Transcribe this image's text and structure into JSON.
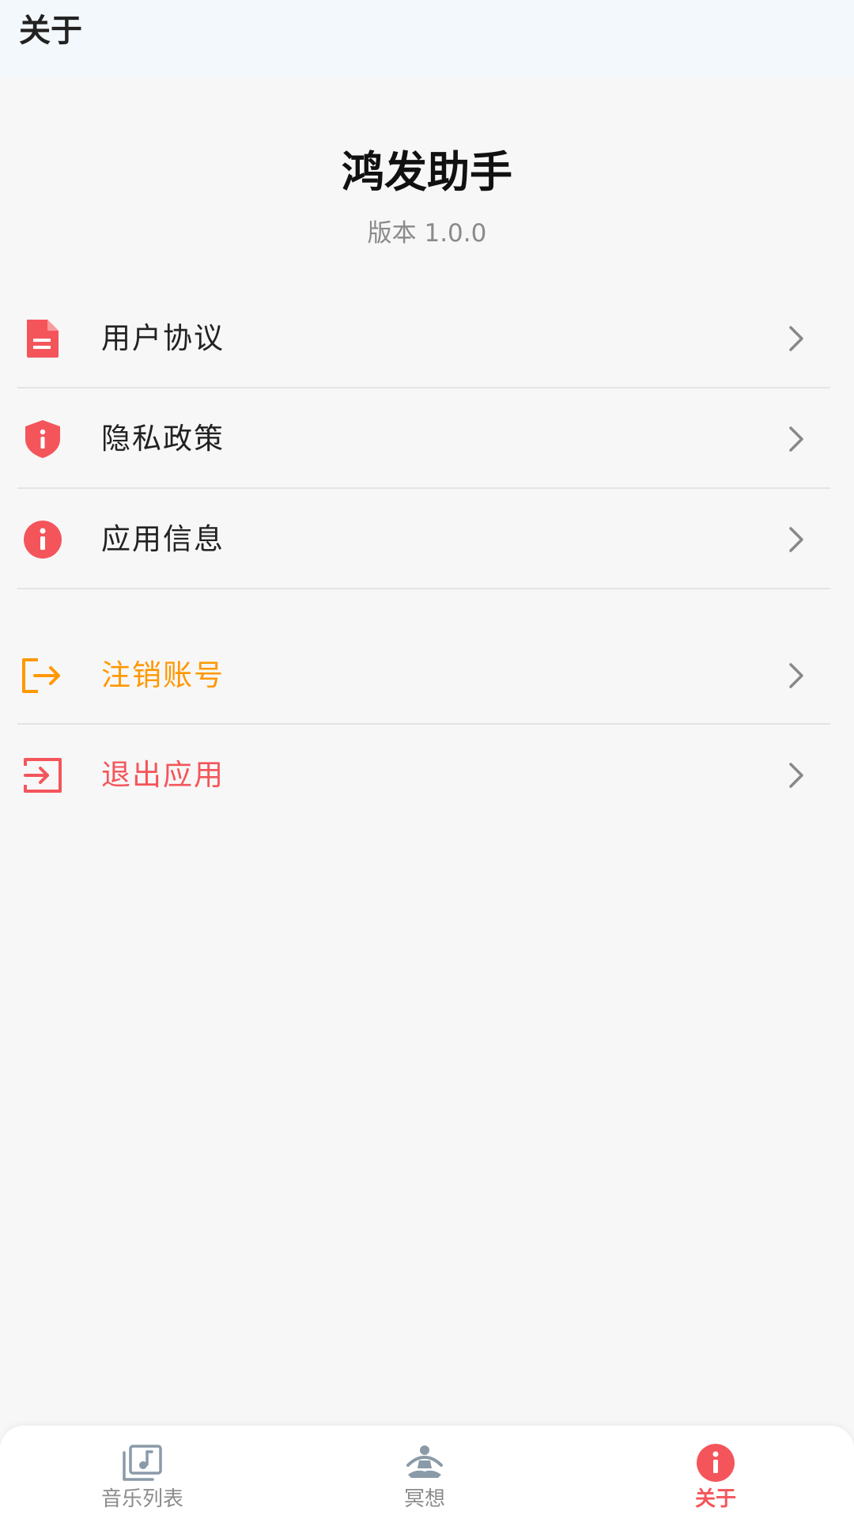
{
  "header": {
    "title": "关于"
  },
  "app": {
    "name": "鸿发助手",
    "version": "版本 1.0.0"
  },
  "menu": {
    "items": [
      {
        "label": "用户协议",
        "icon": "document-icon"
      },
      {
        "label": "隐私政策",
        "icon": "shield-icon"
      },
      {
        "label": "应用信息",
        "icon": "info-icon"
      }
    ],
    "account_items": [
      {
        "label": "注销账号",
        "icon": "logout-icon"
      },
      {
        "label": "退出应用",
        "icon": "exit-app-icon"
      }
    ]
  },
  "tabbar": {
    "tabs": [
      {
        "label": "音乐列表",
        "icon": "music-library-icon",
        "active": false
      },
      {
        "label": "冥想",
        "icon": "meditation-icon",
        "active": false
      },
      {
        "label": "关于",
        "icon": "info-icon",
        "active": true
      }
    ]
  },
  "colors": {
    "accent": "#f4555b",
    "warning": "#ff9800",
    "inactive": "#8c8c8c",
    "header_bg": "#f3f8fc",
    "page_bg": "#f7f7f7"
  }
}
